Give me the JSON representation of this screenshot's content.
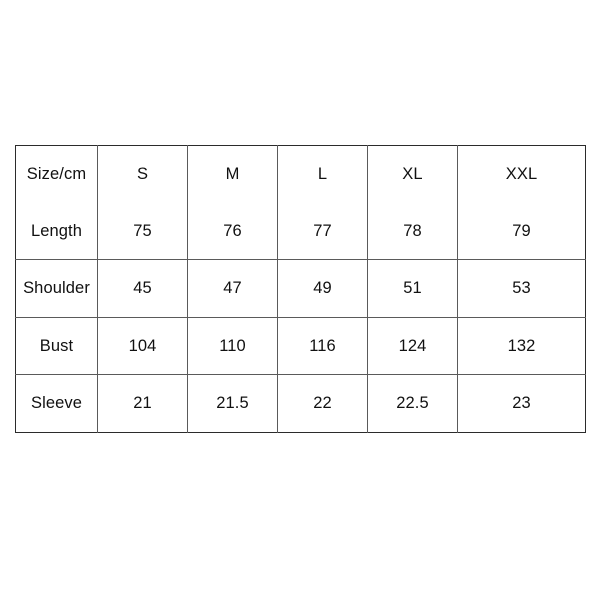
{
  "table": {
    "title": "Size/cm",
    "header": [
      "Size/cm",
      "S",
      "M",
      "L",
      "XL",
      "XXL"
    ],
    "rows": [
      {
        "label": "Length",
        "values": [
          "75",
          "76",
          "77",
          "78",
          "79"
        ]
      },
      {
        "label": "Shoulder",
        "values": [
          "45",
          "47",
          "49",
          "51",
          "53"
        ]
      },
      {
        "label": "Bust",
        "values": [
          "104",
          "110",
          "116",
          "124",
          "132"
        ]
      },
      {
        "label": "Sleeve",
        "values": [
          "21",
          "21.5",
          "22",
          "22.5",
          "23"
        ]
      }
    ]
  },
  "chart_data": {
    "type": "table",
    "title": "Size/cm",
    "columns": [
      "Size/cm",
      "S",
      "M",
      "L",
      "XL",
      "XXL"
    ],
    "rows": [
      {
        "measurement": "Length",
        "S": 75,
        "M": 76,
        "L": 77,
        "XL": 78,
        "XXL": 79
      },
      {
        "measurement": "Shoulder",
        "S": 45,
        "M": 47,
        "L": 49,
        "XL": 51,
        "XXL": 53
      },
      {
        "measurement": "Bust",
        "S": 104,
        "M": 110,
        "L": 116,
        "XL": 124,
        "XXL": 132
      },
      {
        "measurement": "Sleeve",
        "S": 21,
        "M": 21.5,
        "L": 22,
        "XL": 22.5,
        "XXL": 23
      }
    ],
    "unit": "cm",
    "series": [
      {
        "name": "Length",
        "values": [
          75,
          76,
          77,
          78,
          79
        ]
      },
      {
        "name": "Shoulder",
        "values": [
          45,
          47,
          49,
          51,
          53
        ]
      },
      {
        "name": "Bust",
        "values": [
          104,
          110,
          116,
          124,
          132
        ]
      },
      {
        "name": "Sleeve",
        "values": [
          21,
          21.5,
          22,
          22.5,
          23
        ]
      }
    ],
    "categories": [
      "S",
      "M",
      "L",
      "XL",
      "XXL"
    ]
  },
  "style": {
    "background": "#ffffff",
    "text_color": "#111111",
    "outer_border_color": "#2b2b2b",
    "inner_line_color": "#5a5a5a"
  }
}
